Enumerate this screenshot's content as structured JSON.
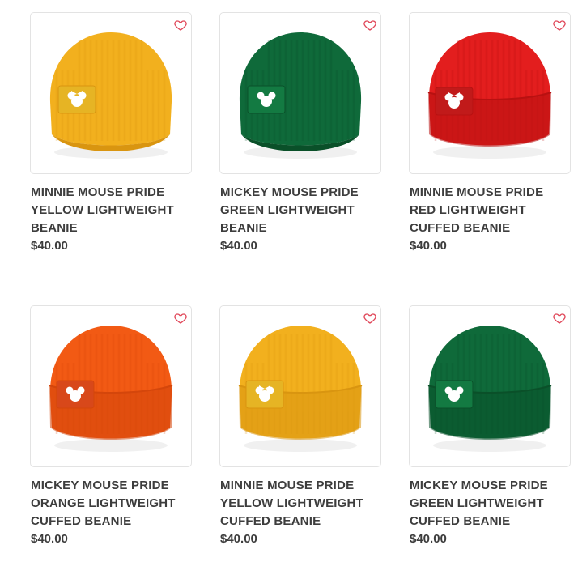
{
  "products": [
    {
      "title": "MINNIE MOUSE PRIDE YELLOW LIGHTWEIGHT BEANIE",
      "price": "$40.00",
      "hat_color": "#f2b01e",
      "hat_shadow": "#d99510",
      "patch_color": "#e6b424",
      "mascot": "minnie",
      "cuffed": false
    },
    {
      "title": "MICKEY MOUSE PRIDE GREEN LIGHTWEIGHT BEANIE",
      "price": "$40.00",
      "hat_color": "#0f6a3a",
      "hat_shadow": "#0a5029",
      "patch_color": "#137a42",
      "mascot": "mickey",
      "cuffed": false
    },
    {
      "title": "MINNIE MOUSE PRIDE RED LIGHTWEIGHT CUFFED BEANIE",
      "price": "$40.00",
      "hat_color": "#e31e1e",
      "hat_shadow": "#b81111",
      "patch_color": "#c11a1a",
      "mascot": "minnie",
      "cuffed": true
    },
    {
      "title": "MICKEY MOUSE PRIDE ORANGE LIGHTWEIGHT CUFFED BEANIE",
      "price": "$40.00",
      "hat_color": "#f25a14",
      "hat_shadow": "#d4460b",
      "patch_color": "#d8481a",
      "mascot": "mickey",
      "cuffed": true
    },
    {
      "title": "MINNIE MOUSE PRIDE YELLOW LIGHTWEIGHT CUFFED BEANIE",
      "price": "$40.00",
      "hat_color": "#f2b01e",
      "hat_shadow": "#d99510",
      "patch_color": "#e6b424",
      "mascot": "minnie",
      "cuffed": true
    },
    {
      "title": "MICKEY MOUSE PRIDE GREEN LIGHTWEIGHT CUFFED BEANIE",
      "price": "$40.00",
      "hat_color": "#0f6a3a",
      "hat_shadow": "#0a5029",
      "patch_color": "#137a42",
      "mascot": "mickey",
      "cuffed": true
    }
  ],
  "heart_icon": "heart-outline-icon",
  "heart_color": "#e0485a"
}
